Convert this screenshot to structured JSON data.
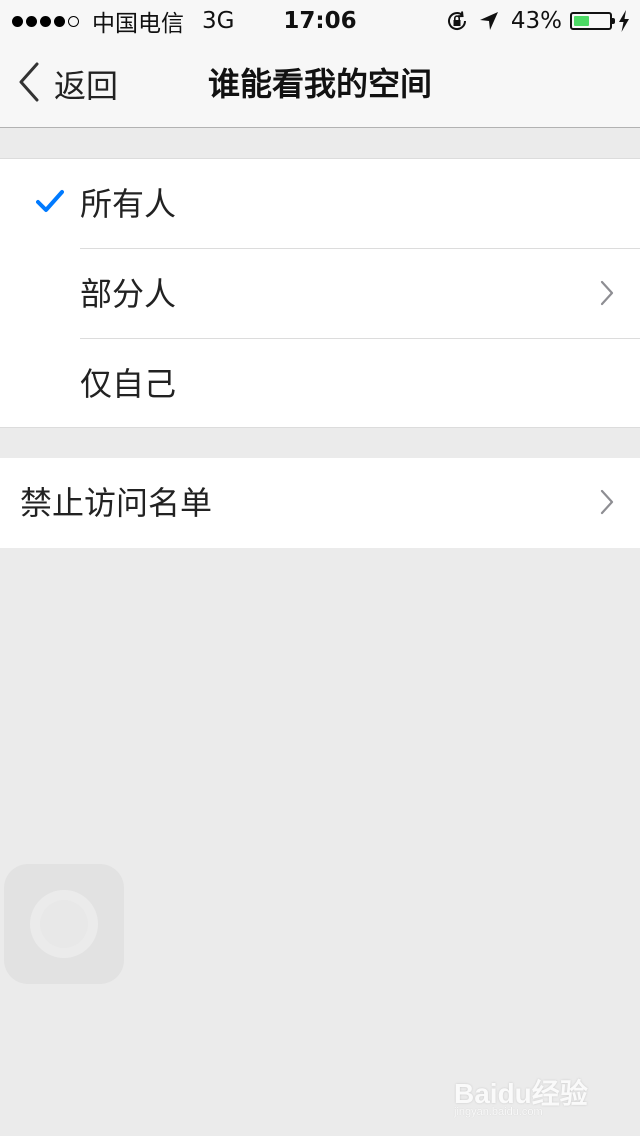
{
  "status_bar": {
    "carrier": "中国电信",
    "network": "3G",
    "time": "17:06",
    "battery_percent": "43%",
    "battery_level": 0.43,
    "signal_bars_filled": 4,
    "signal_bars_total": 5,
    "icons": [
      "rotation-lock-icon",
      "location-arrow-icon",
      "battery-icon",
      "charging-bolt-icon"
    ],
    "battery_color": "#4cd964"
  },
  "nav": {
    "back_label": "返回",
    "title": "谁能看我的空间",
    "back_icon": "chevron-left-icon"
  },
  "visibility_options": [
    {
      "label": "所有人",
      "selected": true
    },
    {
      "label": "部分人",
      "has_disclosure": true
    },
    {
      "label": "仅自己"
    }
  ],
  "block_list": {
    "label": "禁止访问名单"
  },
  "colors": {
    "accent": "#007aff",
    "background": "#ebebeb",
    "cell_background": "#ffffff"
  },
  "watermark": {
    "main": "Baidu经验",
    "sub": "jingyan.baidu.com"
  }
}
